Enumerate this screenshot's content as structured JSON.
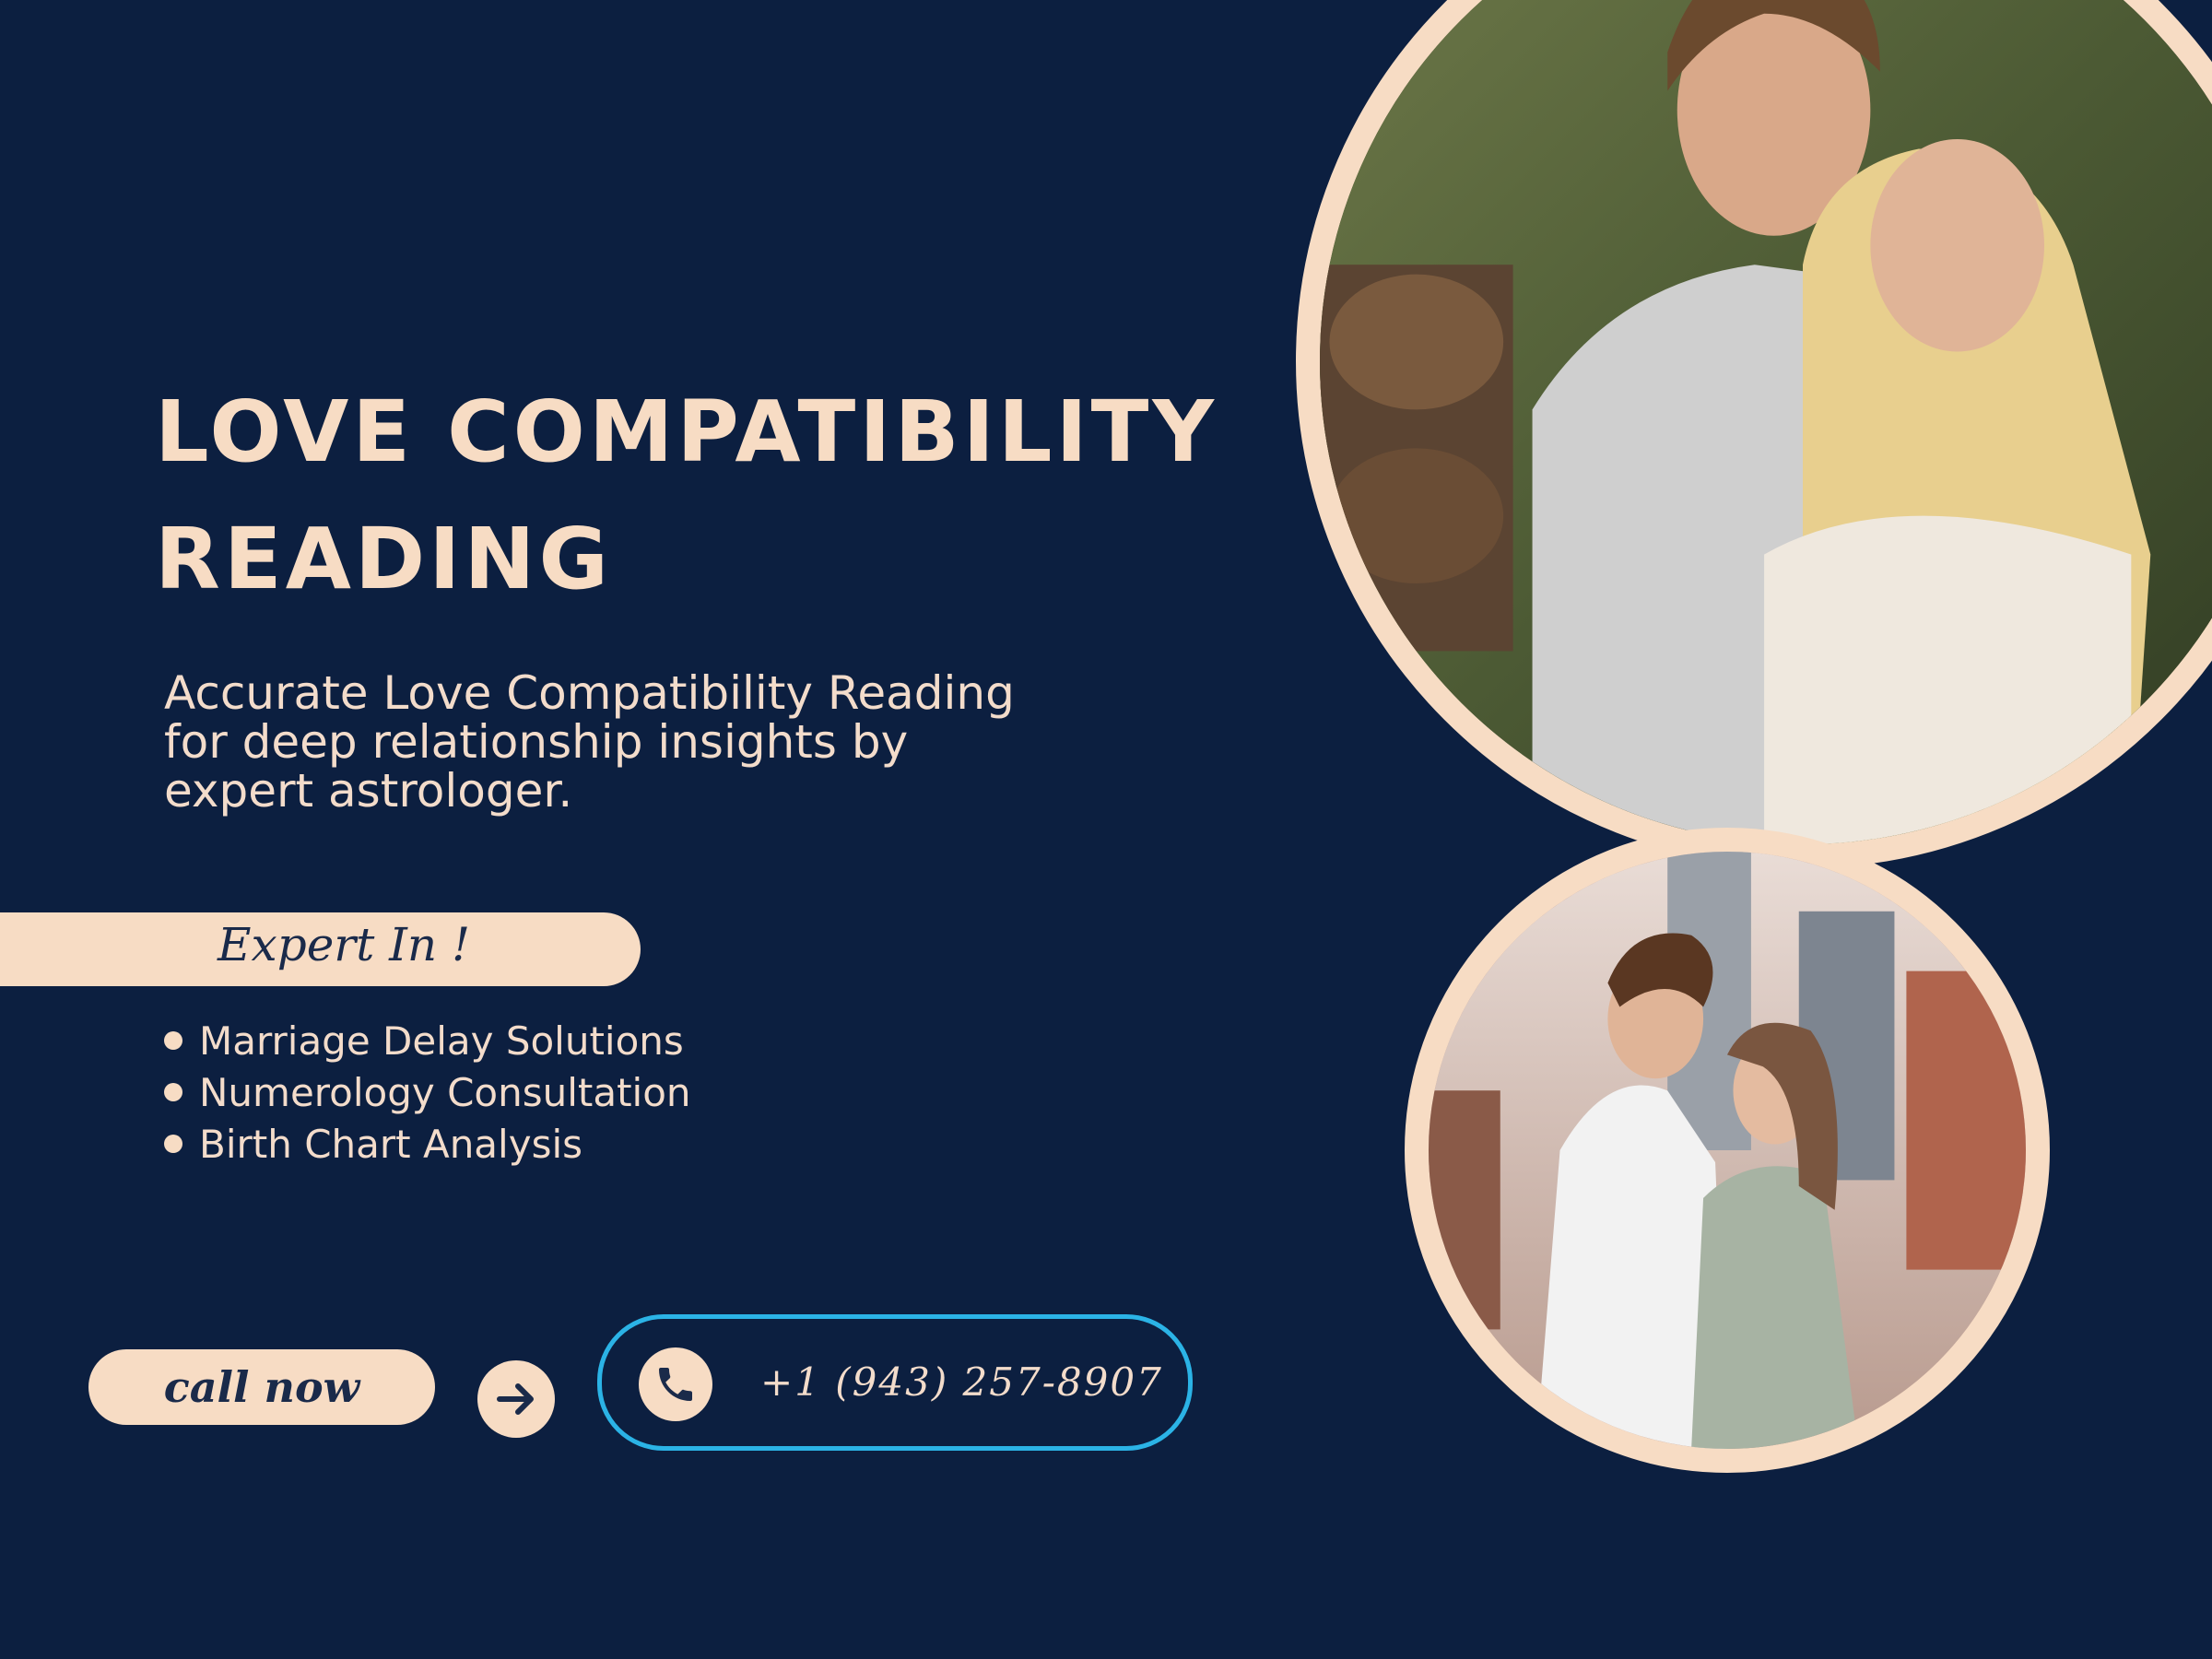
{
  "heading": {
    "line1": "LOVE COMPATIBILITY",
    "line2": "READING"
  },
  "subtitle": {
    "line1": "Accurate Love Compatibility Reading",
    "line2": "for deep relationship insights by",
    "line3": "expert astrologer."
  },
  "expert": {
    "label": "Expert In !",
    "items": [
      "Marriage Delay Solutions",
      "Numerology Consultation",
      "Birth Chart Analysis"
    ]
  },
  "cta": {
    "call_label": "call now",
    "arrow_icon": "arrow-right-icon",
    "phone_icon": "phone-icon",
    "phone_number": "+1 (943) 257-8907"
  },
  "colors": {
    "background": "#0c1f40",
    "cream": "#f7dcc4",
    "accent_border": "#2bb3e6"
  }
}
